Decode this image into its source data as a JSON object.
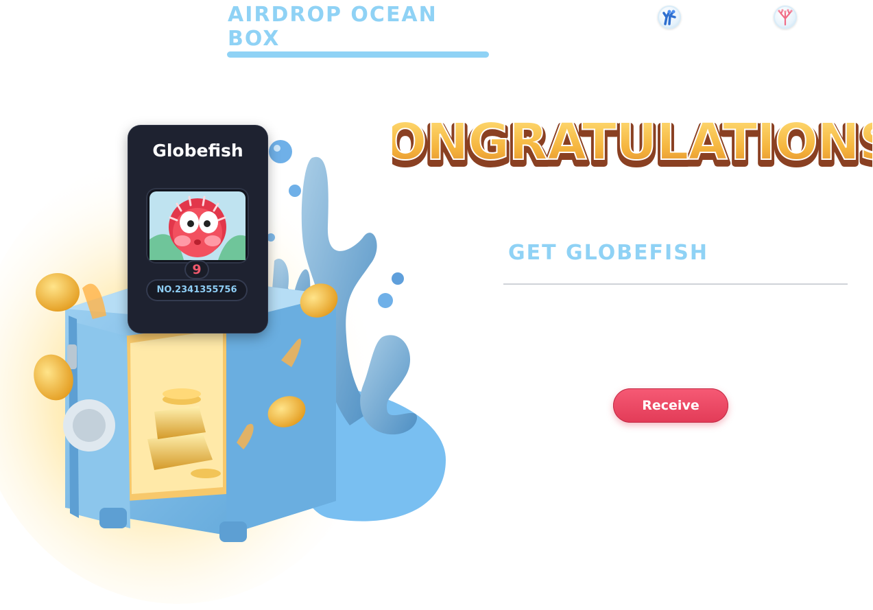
{
  "header": {
    "tab_title": "AIRDROP OCEAN BOX",
    "icons": [
      "blue-coral-icon",
      "pink-coral-icon"
    ]
  },
  "card": {
    "name": "Globefish",
    "level": "9",
    "number": "NO.2341355756"
  },
  "result": {
    "congrats": "CONGRATULATIONS!",
    "get_text": "GET GLOBEFISH",
    "receive_label": "Receive"
  },
  "colors": {
    "accent_blue": "#8fd2f5",
    "button_red": "#e8445f",
    "card_bg": "#1e2230"
  }
}
